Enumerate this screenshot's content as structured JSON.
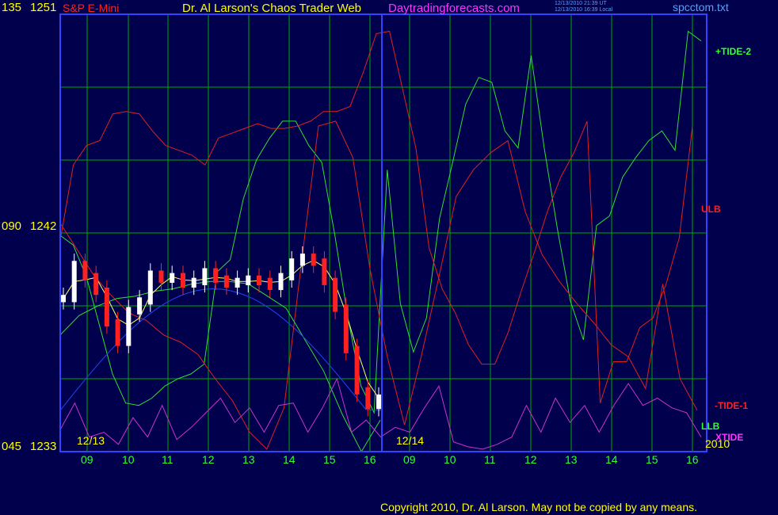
{
  "header": {
    "left_axis_top": "135",
    "price_top": "1251",
    "symbol": "S&P E-Mini",
    "title": "Dr. Al Larson's Chaos Trader Web",
    "site": "Daytradingforecasts.com",
    "time_ut": "12/13/2010 21:39 UT",
    "time_local": "12/13/2010 16:39 Local",
    "file": "spcctom.txt"
  },
  "axis": {
    "left_mid": "090",
    "price_mid": "1242",
    "left_bottom": "045",
    "price_bottom": "1233",
    "date1": "12/13",
    "date2": "12/14",
    "year": "2010",
    "hours": [
      "09",
      "10",
      "11",
      "12",
      "13",
      "14",
      "15",
      "16",
      "09",
      "10",
      "11",
      "12",
      "13",
      "14",
      "15",
      "16"
    ]
  },
  "labels": {
    "tide2": "+TIDE-2",
    "ulb": "ULB",
    "tide1": "-TIDE-1",
    "llb": "LLB",
    "xtide": "XTIDE"
  },
  "footer": {
    "copyright": "Copyright 2010, Dr. Al Larson. May not be copied by any means."
  },
  "colors": {
    "background": "#00004d",
    "grid": "#00aa00",
    "frame": "#3344ff",
    "price_up": "#ffffff",
    "price_down": "#ff2020",
    "ulb": "#e02020",
    "tide": "#33dd33",
    "xtide": "#cc33cc",
    "blue_curve": "#2244ee",
    "yellow_ma": "#ffff66"
  },
  "chart_data": {
    "type": "line",
    "title": "S&P E-Mini",
    "y_price_ticks": [
      1233,
      1242,
      1251
    ],
    "y_left_ticks": [
      "045",
      "090",
      "135"
    ],
    "ylim": [
      1233,
      1251
    ],
    "x_hours": [
      "09",
      "10",
      "11",
      "12",
      "13",
      "14",
      "15",
      "16",
      "09",
      "10",
      "11",
      "12",
      "13",
      "14",
      "15",
      "16"
    ],
    "price_close": [
      1239.3,
      1240.7,
      1240.2,
      1239.6,
      1238.3,
      1237.5,
      1238.8,
      1239.2,
      1240.3,
      1240.1,
      1240.2,
      1239.9,
      1240.0,
      1240.4,
      1240.1,
      1239.9,
      1240.0,
      1240.1,
      1240.0,
      1239.8,
      1240.2,
      1240.8,
      1241.0,
      1240.8,
      1240.0,
      1238.9,
      1237.2,
      1235.5,
      1234.9,
      1235.2
    ],
    "series": [
      {
        "name": "+TIDE-2",
        "values": [
          1241.9,
          1241.5,
          1240.2,
          1238.2,
          1236.2,
          1235.0,
          1234.9,
          1235.2,
          1235.7,
          1236.0,
          1236.2,
          1236.6,
          1240.4,
          1240.9,
          1243.4,
          1245.0,
          1245.9,
          1246.6,
          1246.6,
          1245.6,
          1244.9,
          1241.9,
          1238.5,
          1235.7,
          1234.6,
          1244.6,
          1239.1,
          1237.1,
          1238.5,
          1242.6,
          1244.9,
          1247.3,
          1248.4,
          1248.2,
          1246.2,
          1245.5,
          1249.3,
          1245.5,
          1242.2,
          1239.2,
          1237.6,
          1242.3,
          1242.7,
          1244.3,
          1245.1,
          1245.8,
          1246.2,
          1245.4,
          1250.3,
          1249.9
        ]
      },
      {
        "name": "ULB",
        "values": [
          1241.7,
          1244.8,
          1245.6,
          1245.8,
          1246.9,
          1247.0,
          1246.9,
          1246.2,
          1245.6,
          1245.4,
          1245.2,
          1244.8,
          1245.9,
          1246.1,
          1246.3,
          1246.5,
          1246.3,
          1246.3,
          1246.4,
          1246.6,
          1247.0,
          1247.0,
          1247.2,
          1248.6,
          1250.2,
          1250.3,
          1247.9,
          1245.5,
          1241.4,
          1239.7,
          1238.7,
          1237.4,
          1236.6,
          1236.6,
          1237.9,
          1239.6,
          1241.2,
          1242.9,
          1244.3,
          1245.3,
          1246.6,
          1235.0,
          1236.7,
          1236.7,
          1238.1,
          1238.5,
          1239.9,
          1241.8,
          1246.4
        ]
      },
      {
        "name": "-TIDE-1",
        "values": [
          1242.4,
          1241.3,
          1240.2,
          1239.4,
          1238.7,
          1238.4,
          1237.8,
          1237.5,
          1237.0,
          1236.0,
          1235.1,
          1233.8,
          1233.1,
          1234.8,
          1240.7,
          1246.4,
          1246.6,
          1245.1,
          1240.5,
          1236.9,
          1234.1,
          1237.0,
          1240.2,
          1243.5,
          1244.6,
          1245.3,
          1245.8,
          1242.9,
          1241.1,
          1240.0,
          1239.1,
          1238.3,
          1237.4,
          1236.9,
          1235.6,
          1239.9,
          1236.0,
          1234.7
        ]
      },
      {
        "name": "LLB",
        "values": [
          1237.8,
          1238.6,
          1239.0,
          1239.3,
          1239.4,
          1239.6,
          1239.7,
          1239.9,
          1240.0,
          1240.0,
          1239.9,
          1239.4,
          1238.9,
          1237.6,
          1236.3,
          1234.5,
          1233.0,
          1234.3
        ]
      },
      {
        "name": "XTIDE",
        "values": [
          1233.9,
          1235.0,
          1233.6,
          1233.8,
          1233.3,
          1234.4,
          1233.6,
          1234.9,
          1233.5,
          1234.0,
          1234.6,
          1235.2,
          1234.2,
          1234.8,
          1233.8,
          1234.9,
          1235.0,
          1233.8,
          1234.8,
          1236.0,
          1233.8,
          1234.3,
          1233.6,
          1234.0,
          1233.8,
          1234.8,
          1235.7,
          1233.4,
          1233.2,
          1233.1,
          1233.3,
          1233.6,
          1234.9,
          1233.8,
          1235.2,
          1234.2,
          1234.9,
          1233.8,
          1234.9,
          1235.8,
          1234.9,
          1235.2,
          1234.8,
          1234.6,
          1233.6
        ]
      }
    ],
    "grid": true,
    "vertical_separator_at": "16 (12/13)"
  }
}
